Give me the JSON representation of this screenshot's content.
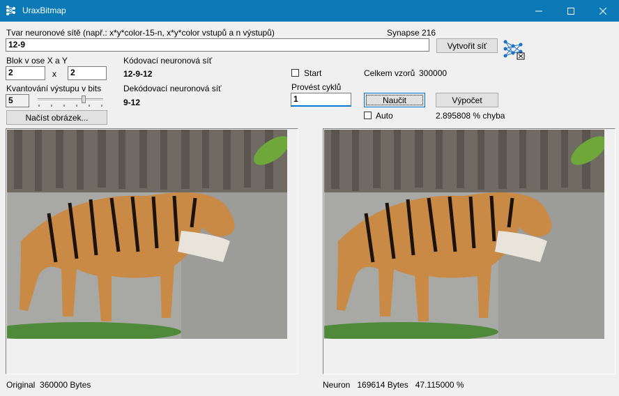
{
  "window": {
    "title": "UraxBitmap"
  },
  "network": {
    "shape_label": "Tvar neuronové sítě (např.: x*y*color-15-n, x*y*color vstupů a n výstupů)",
    "synapse_label": "Synapse 216",
    "shape_value": "12-9",
    "create_button": "Vytvořit síť"
  },
  "block": {
    "label": "Blok v ose X a Y",
    "x_value": "2",
    "separator": "x",
    "y_value": "2"
  },
  "quant": {
    "label": "Kvantování výstupu v bits",
    "value": "5",
    "slider_position_fraction": 0.72
  },
  "load_button": "Načíst obrázek...",
  "coding": {
    "label": "Kódovací neuronová síť",
    "value": "12-9-12"
  },
  "decoding": {
    "label": "Dekódovací neuronová síť",
    "value": "9-12"
  },
  "start": {
    "label": "Start",
    "checked": false
  },
  "cycles": {
    "label": "Provést cyklů",
    "value": "1"
  },
  "learn_button": "Naučit",
  "auto": {
    "label": "Auto",
    "checked": false
  },
  "samples": {
    "label": "Celkem vzorů",
    "value": "300000"
  },
  "compute_button": "Výpočet",
  "error_text": "2.895808 % chyba",
  "original": {
    "caption": "Original  360000 Bytes"
  },
  "neuron": {
    "caption": "Neuron   169614 Bytes   47.115000 %"
  },
  "colors": {
    "titlebar": "#0a79b5",
    "background": "#f0f0f0"
  }
}
